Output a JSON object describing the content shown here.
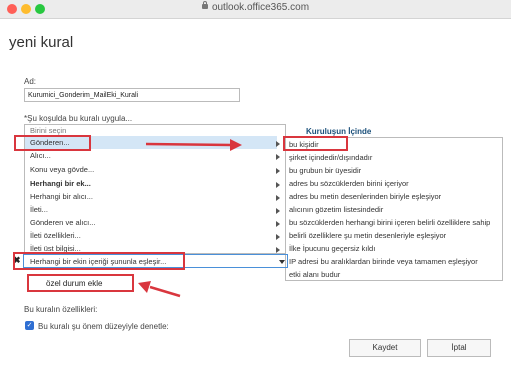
{
  "window": {
    "url": "outlook.office365.com"
  },
  "dialog": {
    "title": "yeni kural",
    "name_label": "Ad:",
    "name_value": "Kurumici_Gonderim_MailEki_Kurali",
    "conditions_label": "*Şu koşulda bu kuralı uygula...",
    "condition_options": [
      "Birini seçin",
      "Gönderen...",
      "Alıcı...",
      "Konu veya gövde...",
      "Herhangi bir ek...",
      "Herhangi bir alıcı...",
      "İleti...",
      "Gönderen ve alıcı...",
      "İleti özellikleri...",
      "İleti üst bilgisi..."
    ],
    "submenu_header": "Kuruluşun İçinde",
    "submenu_options": [
      "bu kişidir",
      "şirket içindedir/dışındadır",
      "bu grubun bir üyesidir",
      "adres bu sözcüklerden birini içeriyor",
      "adres bu metin desenlerinden biriyle eşleşiyor",
      "alıcının gözetim listesindedir",
      "bu sözcüklerden herhangi birini içeren belirli özelliklere sahip",
      "belirli özelliklere şu metin desenleriyle eşleşiyor",
      "İlke İpucunu geçersiz kıldı",
      "IP adresi bu aralıklardan birinde veya tamamen eşleşiyor",
      "etki alanı budur"
    ],
    "selected_condition": "Herhangi bir ekin içeriği şununla eşleşir...",
    "remove_glyph": "✖",
    "add_condition_label": "özel durum ekle",
    "properties_label": "Bu kuralın özellikleri:",
    "audit_checkbox_label": "Bu kuralı şu önem düzeyiyle denetle:",
    "audit_checked": true,
    "save_button": "Kaydet",
    "cancel_button": "İptal"
  },
  "colors": {
    "highlight": "#d4e6f6",
    "annotation_red": "#d9363e",
    "accent": "#2f6fd3"
  }
}
